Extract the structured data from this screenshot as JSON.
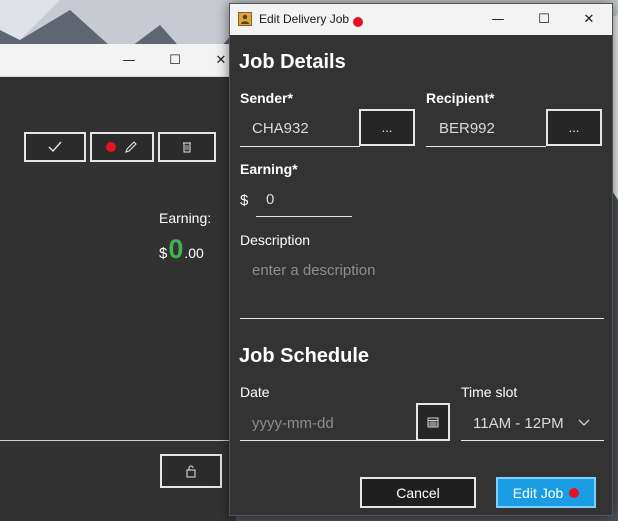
{
  "dialog": {
    "title": "Edit Delivery Job",
    "app_icon": "contact-card-icon",
    "minimize_glyph": "—",
    "maximize_glyph": "☐",
    "close_glyph": "✕",
    "sections": {
      "details_title": "Job Details",
      "schedule_title": "Job Schedule"
    },
    "sender": {
      "label": "Sender*",
      "value": "CHA932",
      "picker_label": "..."
    },
    "recipient": {
      "label": "Recipient*",
      "value": "BER992",
      "picker_label": "..."
    },
    "earning": {
      "label": "Earning*",
      "currency": "$",
      "value": "0"
    },
    "description": {
      "label": "Description",
      "placeholder": "enter a description"
    },
    "date": {
      "label": "Date",
      "placeholder": "yyyy-mm-dd",
      "picker_icon": "calendar-icon"
    },
    "time_slot": {
      "label": "Time slot",
      "value": "11AM - 12PM",
      "icon": "chevron-down-icon"
    },
    "buttons": {
      "cancel": "Cancel",
      "edit": "Edit Job"
    }
  },
  "background_window": {
    "minimize_glyph": "—",
    "maximize_glyph": "☐",
    "close_glyph": "✕",
    "toolbar": {
      "complete_icon": "checkmark-icon",
      "edit_icon": "pencil-icon",
      "delete_icon": "trash-icon"
    },
    "earning": {
      "label": "Earning:",
      "dollar": "$",
      "whole": "0",
      "cents": ".00"
    },
    "lock_icon": "unlock-icon"
  },
  "colors": {
    "accent": "#1b9de3",
    "earning_green": "#3fb34f",
    "marker_red": "#e81123",
    "dialog_bg": "#333333"
  }
}
